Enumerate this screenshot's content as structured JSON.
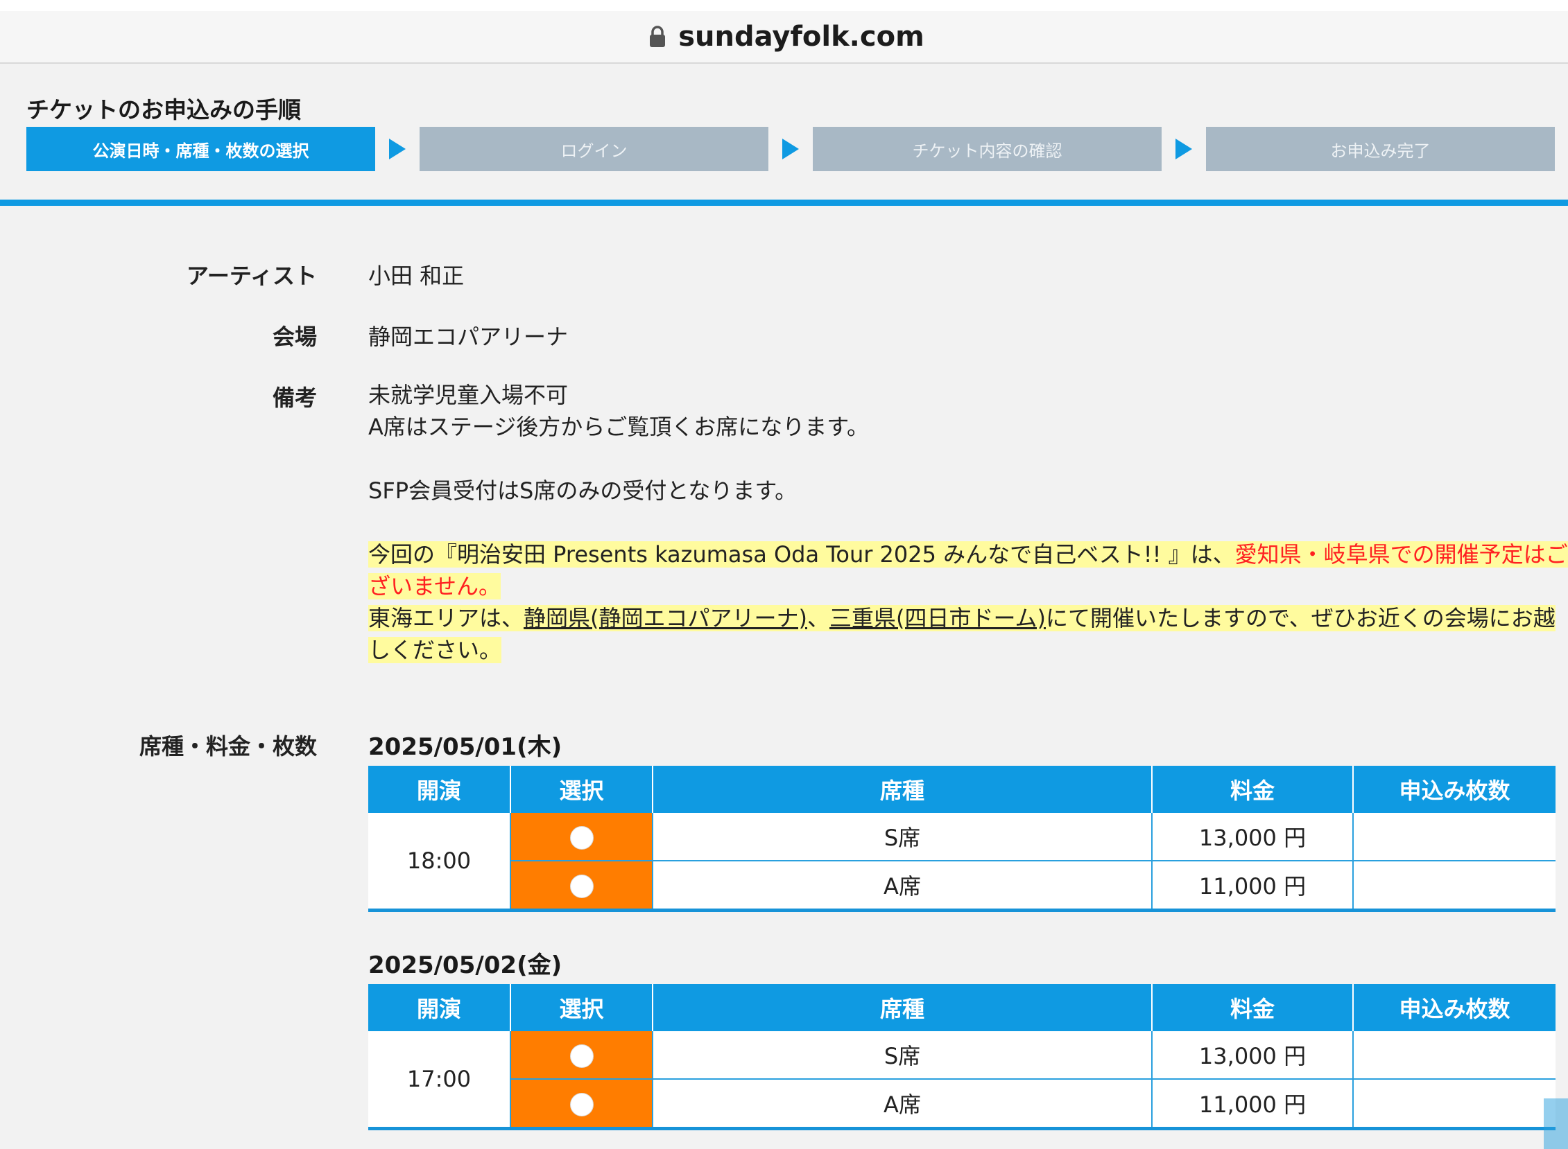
{
  "browser": {
    "url": "sundayfolk.com"
  },
  "steps": {
    "title": "チケットのお申込みの手順",
    "items": [
      {
        "label": "公演日時・席種・枚数の選択"
      },
      {
        "label": "ログイン"
      },
      {
        "label": "チケット内容の確認"
      },
      {
        "label": "お申込み完了"
      }
    ]
  },
  "info": {
    "artist_label": "アーティスト",
    "artist": "小田 和正",
    "venue_label": "会場",
    "venue": "静岡エコパアリーナ",
    "notes_label": "備考",
    "notes": [
      "未就学児童入場不可",
      "A席はステージ後方からご覧頂くお席になります。",
      "SFP会員受付はS席のみの受付となります。"
    ],
    "notice": {
      "line1_pre": "今回の『明治安田 Presents kazumasa Oda Tour 2025 みんなで自己ベスト!! 』は、",
      "line1_red": "愛知県・岐阜県での開催予定はご",
      "line2_red": "ざいません。",
      "line3_pre": "東海エリアは、",
      "line3_link1": "静岡県(静岡エコパアリーナ)",
      "line3_sep": "、",
      "line3_link2": "三重県(四日市ドーム)",
      "line3_post": "にて開催いたしますので、ぜひお近くの会場にお越",
      "line4": "しください。"
    }
  },
  "seating": {
    "label": "席種・料金・枚数",
    "columns": [
      "開演",
      "選択",
      "席種",
      "料金",
      "申込み枚数"
    ],
    "dates": [
      {
        "date": "2025/05/01(木)",
        "time": "18:00",
        "rows": [
          {
            "seat": "S席",
            "price": "13,000 円",
            "qty": ""
          },
          {
            "seat": "A席",
            "price": "11,000 円",
            "qty": ""
          }
        ]
      },
      {
        "date": "2025/05/02(金)",
        "time": "17:00",
        "rows": [
          {
            "seat": "S席",
            "price": "13,000 円",
            "qty": ""
          },
          {
            "seat": "A席",
            "price": "11,000 円",
            "qty": ""
          }
        ]
      }
    ]
  },
  "colors": {
    "accent": "#0f9ae2",
    "select_cell": "#ff7d00",
    "inactive_step": "#a8b8c5",
    "highlight": "#fffb9e",
    "warning": "#ff2020"
  }
}
